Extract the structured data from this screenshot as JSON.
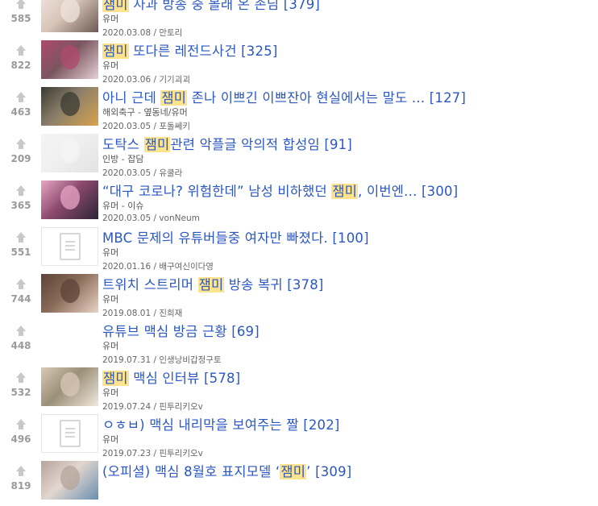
{
  "posts": [
    {
      "score": "585",
      "parts": [
        {
          "t": "잼미",
          "h": true
        },
        {
          "t": " 사과 방송 중 몰래 온 손님",
          "h": false
        }
      ],
      "count": "[379]",
      "category": "유머",
      "date": "2020.03.08",
      "author": "만토리",
      "thumb": "photo",
      "thumb_colors": [
        "#efe4dd",
        "#6b5a54",
        "#d8c4b8"
      ]
    },
    {
      "score": "822",
      "parts": [
        {
          "t": "잼미",
          "h": true
        },
        {
          "t": " 또다른 레전드사건",
          "h": false
        }
      ],
      "count": "[325]",
      "category": "유머",
      "date": "2020.03.06",
      "author": "기기괴괴",
      "thumb": "photo",
      "thumb_colors": [
        "#b04a6c",
        "#e6d0d6",
        "#7a5560"
      ]
    },
    {
      "score": "463",
      "parts": [
        {
          "t": "아니 근데 ",
          "h": false
        },
        {
          "t": "잼미",
          "h": true
        },
        {
          "t": " 존나 이쁘긴 이쁘잔아 현실에서는 말도 ...",
          "h": false
        }
      ],
      "count": "[127]",
      "category": "해외축구 - 옆동네/유머",
      "date": "2020.03.05",
      "author": "포돌쎄키",
      "thumb": "photo",
      "thumb_colors": [
        "#3a3a32",
        "#d9a24d",
        "#8b7f6a"
      ]
    },
    {
      "score": "209",
      "parts": [
        {
          "t": "도탁스 ",
          "h": false
        },
        {
          "t": "잼미",
          "h": true
        },
        {
          "t": "관련 악플글 악의적 합성임",
          "h": false
        }
      ],
      "count": "[91]",
      "category": "인방 - 잡담",
      "date": "2020.03.05",
      "author": "유쿨라",
      "thumb": "photo",
      "thumb_colors": [
        "#f4f4f4",
        "#e2e2e2",
        "#f0f0f0"
      ]
    },
    {
      "score": "365",
      "parts": [
        {
          "t": "“대구 코로나? 위험한데” 남성 비하했던 ",
          "h": false
        },
        {
          "t": "잼미",
          "h": true
        },
        {
          "t": ", 이번엔...",
          "h": false
        }
      ],
      "count": "[300]",
      "category": "유머 - 이슈",
      "date": "2020.03.05",
      "author": "vonNeum",
      "thumb": "photo",
      "thumb_colors": [
        "#e8a6c4",
        "#2c2436",
        "#8c4a6e"
      ]
    },
    {
      "score": "551",
      "parts": [
        {
          "t": "MBC 문제의 유튜버들중 여자만 빠졌다.",
          "h": false
        }
      ],
      "count": "[100]",
      "category": "유머",
      "date": "2020.01.16",
      "author": "배구여신이다영",
      "thumb": "doc",
      "thumb_colors": []
    },
    {
      "score": "744",
      "parts": [
        {
          "t": "트위치 스트리머 ",
          "h": false
        },
        {
          "t": "잼미",
          "h": true
        },
        {
          "t": " 방송 복귀",
          "h": false
        }
      ],
      "count": "[378]",
      "category": "유머",
      "date": "2019.08.01",
      "author": "진희재",
      "thumb": "photo",
      "thumb_colors": [
        "#5b4438",
        "#e9d3c6",
        "#8a6a58"
      ]
    },
    {
      "score": "448",
      "parts": [
        {
          "t": "유튜브 맥심 방금 근황",
          "h": false
        }
      ],
      "count": "[69]",
      "category": "유머",
      "date": "2019.07.31",
      "author": "인생낭비갑정구토",
      "thumb": "none",
      "thumb_colors": []
    },
    {
      "score": "532",
      "parts": [
        {
          "t": "잼미",
          "h": true
        },
        {
          "t": " 맥심 인터뷰",
          "h": false
        }
      ],
      "count": "[578]",
      "category": "유머",
      "date": "2019.07.24",
      "author": "핀투리키오v",
      "thumb": "photo",
      "thumb_colors": [
        "#d8c9b7",
        "#f1e8df",
        "#9a8f77"
      ]
    },
    {
      "score": "496",
      "parts": [
        {
          "t": "ㅇㅎㅂ) 맥심 내리막을 보여주는 짤",
          "h": false
        }
      ],
      "count": "[202]",
      "category": "유머",
      "date": "2019.07.23",
      "author": "핀투리키오v",
      "thumb": "doc",
      "thumb_colors": []
    },
    {
      "score": "819",
      "parts": [
        {
          "t": "(오피셜) 맥심 8월호 표지모델 ‘",
          "h": false
        },
        {
          "t": "잼미",
          "h": true
        },
        {
          "t": "’",
          "h": false
        }
      ],
      "count": "[309]",
      "category": "",
      "date": "",
      "author": "",
      "thumb": "photo",
      "thumb_colors": [
        "#b5a49a",
        "#6a8fb0",
        "#e3d6cf"
      ]
    }
  ]
}
